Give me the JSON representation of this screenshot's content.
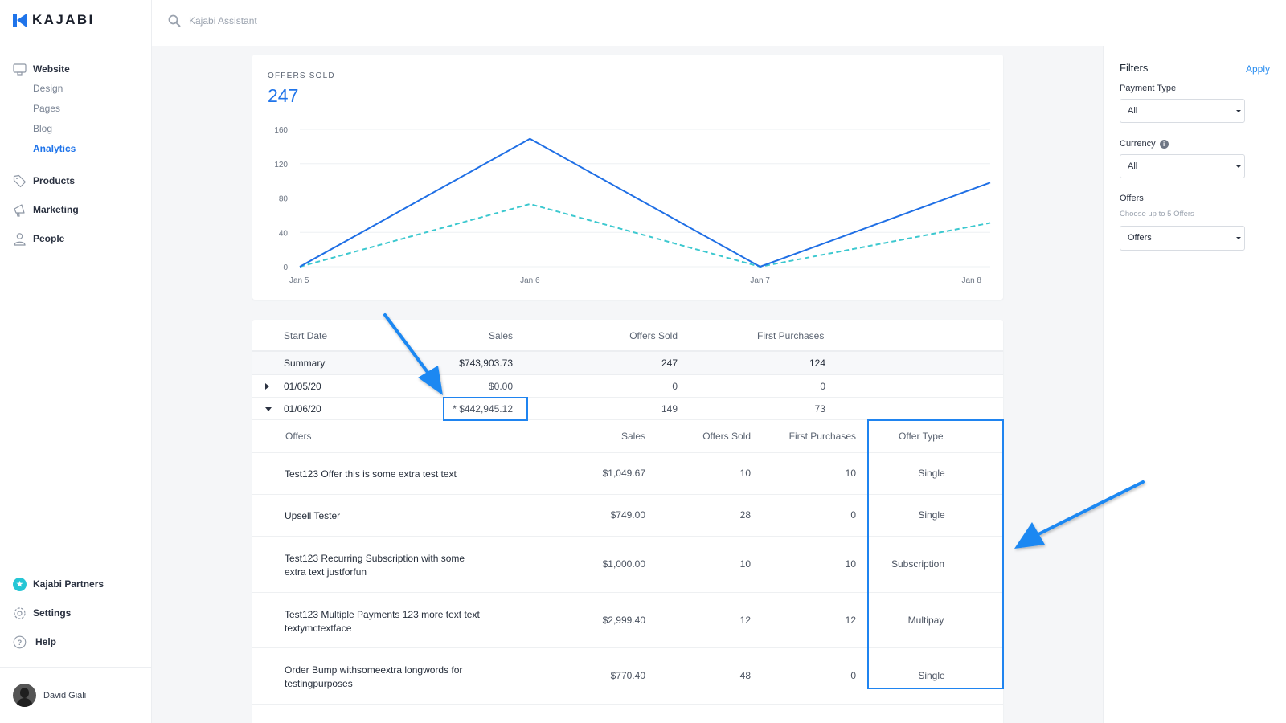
{
  "brand": {
    "name": "KAJABI",
    "accent": "#1f74ea"
  },
  "header": {
    "search_placeholder": "Kajabi Assistant"
  },
  "sidebar": {
    "website": {
      "label": "Website",
      "icon": "monitor-icon",
      "children": [
        {
          "label": "Design",
          "active": false
        },
        {
          "label": "Pages",
          "active": false
        },
        {
          "label": "Blog",
          "active": false
        },
        {
          "label": "Analytics",
          "active": true
        }
      ]
    },
    "items": [
      {
        "label": "Products",
        "icon": "tag-icon"
      },
      {
        "label": "Marketing",
        "icon": "megaphone-icon"
      },
      {
        "label": "People",
        "icon": "person-icon"
      }
    ],
    "bottom": [
      {
        "label": "Kajabi Partners",
        "icon": "star-badge-icon"
      },
      {
        "label": "Settings",
        "icon": "gear-icon"
      },
      {
        "label": "Help",
        "icon": "help-icon"
      }
    ],
    "user": {
      "name": "David Giali"
    }
  },
  "kpi": {
    "label": "OFFERS SOLD",
    "value": "247"
  },
  "chart_data": {
    "type": "line",
    "title": "OFFERS SOLD",
    "x": [
      "Jan 5",
      "Jan 6",
      "Jan 7",
      "Jan 8"
    ],
    "series": [
      {
        "name": "Offers Sold",
        "style": "solid",
        "color": "#1f6fe5",
        "values": [
          0,
          149,
          0,
          98
        ]
      },
      {
        "name": "First Purchases",
        "style": "dashed",
        "color": "#3cc8cf",
        "values": [
          0,
          73,
          0,
          51
        ]
      }
    ],
    "yticks": [
      0,
      40,
      80,
      120,
      160
    ],
    "ylim": [
      0,
      160
    ],
    "xlabel": "",
    "ylabel": "",
    "grid": true,
    "legend": "none"
  },
  "table": {
    "columns": [
      "Start Date",
      "Sales",
      "Offers Sold",
      "First Purchases"
    ],
    "summary": {
      "label": "Summary",
      "sales": "$743,903.73",
      "offers_sold": "247",
      "first_purchases": "124"
    },
    "rows": [
      {
        "date": "01/05/20",
        "sales": "$0.00",
        "offers_sold": "0",
        "first_purchases": "0",
        "expanded": false
      },
      {
        "date": "01/06/20",
        "sales": "* $442,945.12",
        "offers_sold": "149",
        "first_purchases": "73",
        "expanded": true
      }
    ],
    "sub_columns": [
      "Offers",
      "Sales",
      "Offers Sold",
      "First Purchases",
      "Offer Type"
    ],
    "sub_rows": [
      {
        "name": "Test123 Offer this is some extra test text",
        "sales": "$1,049.67",
        "offers_sold": "10",
        "first_purchases": "10",
        "type": "Single"
      },
      {
        "name": "Upsell Tester",
        "sales": "$749.00",
        "offers_sold": "28",
        "first_purchases": "0",
        "type": "Single"
      },
      {
        "name": "Test123 Recurring Subscription with some extra text justforfun",
        "sales": "$1,000.00",
        "offers_sold": "10",
        "first_purchases": "10",
        "type": "Subscription"
      },
      {
        "name": "Test123 Multiple Payments 123 more text text textymctextface",
        "sales": "$2,999.40",
        "offers_sold": "12",
        "first_purchases": "12",
        "type": "Multipay"
      },
      {
        "name": "Order Bump withsomeextra longwords for testingpurposes",
        "sales": "$770.40",
        "offers_sold": "48",
        "first_purchases": "0",
        "type": "Single"
      }
    ]
  },
  "filters": {
    "title": "Filters",
    "apply": "Apply",
    "payment_type": {
      "label": "Payment Type",
      "value": "All"
    },
    "currency": {
      "label": "Currency",
      "value": "All"
    },
    "offers": {
      "label": "Offers",
      "hint": "Choose up to 5 Offers",
      "value": "Offers"
    }
  }
}
